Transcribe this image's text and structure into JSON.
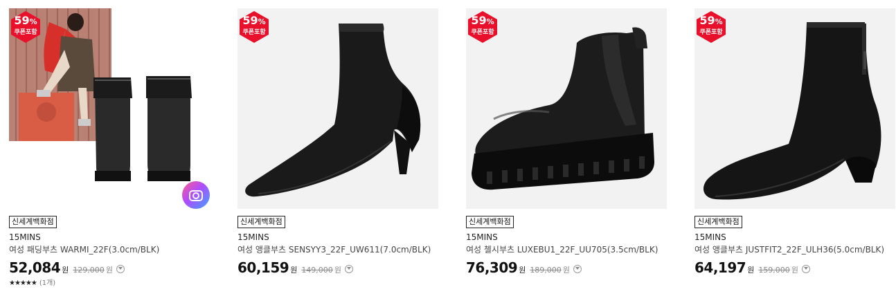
{
  "products": [
    {
      "discount_number": "59",
      "discount_unit": "%",
      "coupon_label": "쿠폰포함",
      "store": "신세계백화점",
      "brand": "15MINS",
      "name": "여성 패딩부츠 WARMI_22F(3.0cm/BLK)",
      "price": "52,084",
      "price_unit": "원",
      "original_price": "129,000",
      "original_unit": "원",
      "stars": "★★★★★",
      "review_count": "(1개)"
    },
    {
      "discount_number": "59",
      "discount_unit": "%",
      "coupon_label": "쿠폰포함",
      "store": "신세계백화점",
      "brand": "15MINS",
      "name": "여성 앵클부츠 SENSYY3_22F_UW611(7.0cm/BLK)",
      "price": "60,159",
      "price_unit": "원",
      "original_price": "149,000",
      "original_unit": "원"
    },
    {
      "discount_number": "59",
      "discount_unit": "%",
      "coupon_label": "쿠폰포함",
      "store": "신세계백화점",
      "brand": "15MINS",
      "name": "여성 첼시부츠 LUXEBU1_22F_UU705(3.5cm/BLK)",
      "price": "76,309",
      "price_unit": "원",
      "original_price": "189,000",
      "original_unit": "원"
    },
    {
      "discount_number": "59",
      "discount_unit": "%",
      "coupon_label": "쿠폰포함",
      "store": "신세계백화점",
      "brand": "15MINS",
      "name": "여성 앵클부츠 JUSTFIT2_22F_ULH36(5.0cm/BLK)",
      "price": "64,197",
      "price_unit": "원",
      "original_price": "159,000",
      "original_unit": "원"
    }
  ],
  "colors": {
    "badge_red": "#e8102a",
    "text_dark": "#111111",
    "text_gray": "#888888"
  },
  "icons": {
    "discount_badge": "hexagon-badge",
    "camera": "camera-icon",
    "price_info": "chevron-down-circle-icon",
    "rating": "star-icon"
  }
}
